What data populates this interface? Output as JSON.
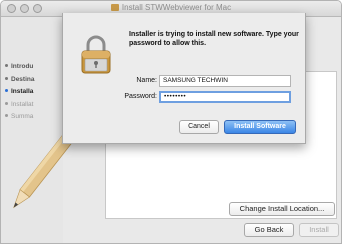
{
  "window": {
    "title": "Install STWWebviewer for Mac"
  },
  "sidebar": {
    "steps": [
      {
        "label": "Introdu"
      },
      {
        "label": "Destina"
      },
      {
        "label": "Installa"
      },
      {
        "label": "Installat"
      },
      {
        "label": "Summa"
      }
    ]
  },
  "main": {
    "change_location_label": "Change Install Location...",
    "go_back_label": "Go Back",
    "install_label": "Install"
  },
  "auth_dialog": {
    "message": "Installer is trying to install new software. Type your password to allow this.",
    "name_label": "Name:",
    "name_value": "SAMSUNG TECHWIN",
    "password_label": "Password:",
    "password_value": "••••••••",
    "cancel_label": "Cancel",
    "install_software_label": "Install Software"
  },
  "colors": {
    "accent": "#3a86e6",
    "window_bg": "#e9e9e9",
    "sheet_bg": "#ececec"
  },
  "icons": [
    "lock-icon",
    "pencil-illustration",
    "package-icon"
  ]
}
